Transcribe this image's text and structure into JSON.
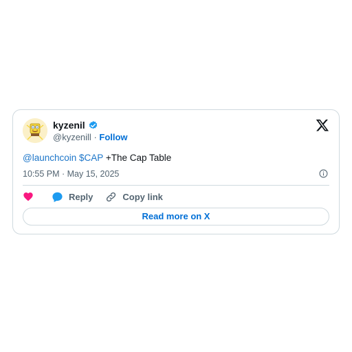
{
  "tweet": {
    "author_name": "kyzenil",
    "handle": "@kyzenill",
    "separator": " · ",
    "follow_label": "Follow",
    "mention": "@launchcoin",
    "cashtag": "$CAP",
    "text_rest": " +The Cap Table",
    "timestamp": "10:55 PM · May 15, 2025"
  },
  "actions": {
    "reply_label": "Reply",
    "copy_link_label": "Copy link"
  },
  "footer": {
    "read_more_label": "Read more on X"
  },
  "colors": {
    "link": "#1d76c9",
    "heart": "#f91880",
    "verified": "#1d9bf0",
    "reply": "#1d9bf0"
  },
  "icons": [
    "avatar-image",
    "verified-badge-icon",
    "x-logo-icon",
    "info-icon",
    "heart-icon",
    "reply-bubble-icon",
    "link-icon"
  ]
}
